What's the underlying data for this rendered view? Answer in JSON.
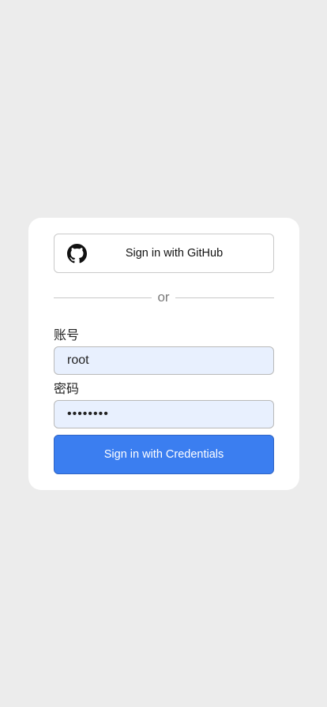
{
  "login": {
    "github_button_label": "Sign in with GitHub",
    "divider_text": "or",
    "account_label": "账号",
    "account_value": "root",
    "password_label": "密码",
    "password_value": "••••••••",
    "submit_label": "Sign in with Credentials"
  },
  "icons": {
    "github": "github-icon"
  },
  "colors": {
    "background": "#ececec",
    "card": "#ffffff",
    "input_fill": "#e8f0fe",
    "primary_button": "#3b7ef0"
  }
}
